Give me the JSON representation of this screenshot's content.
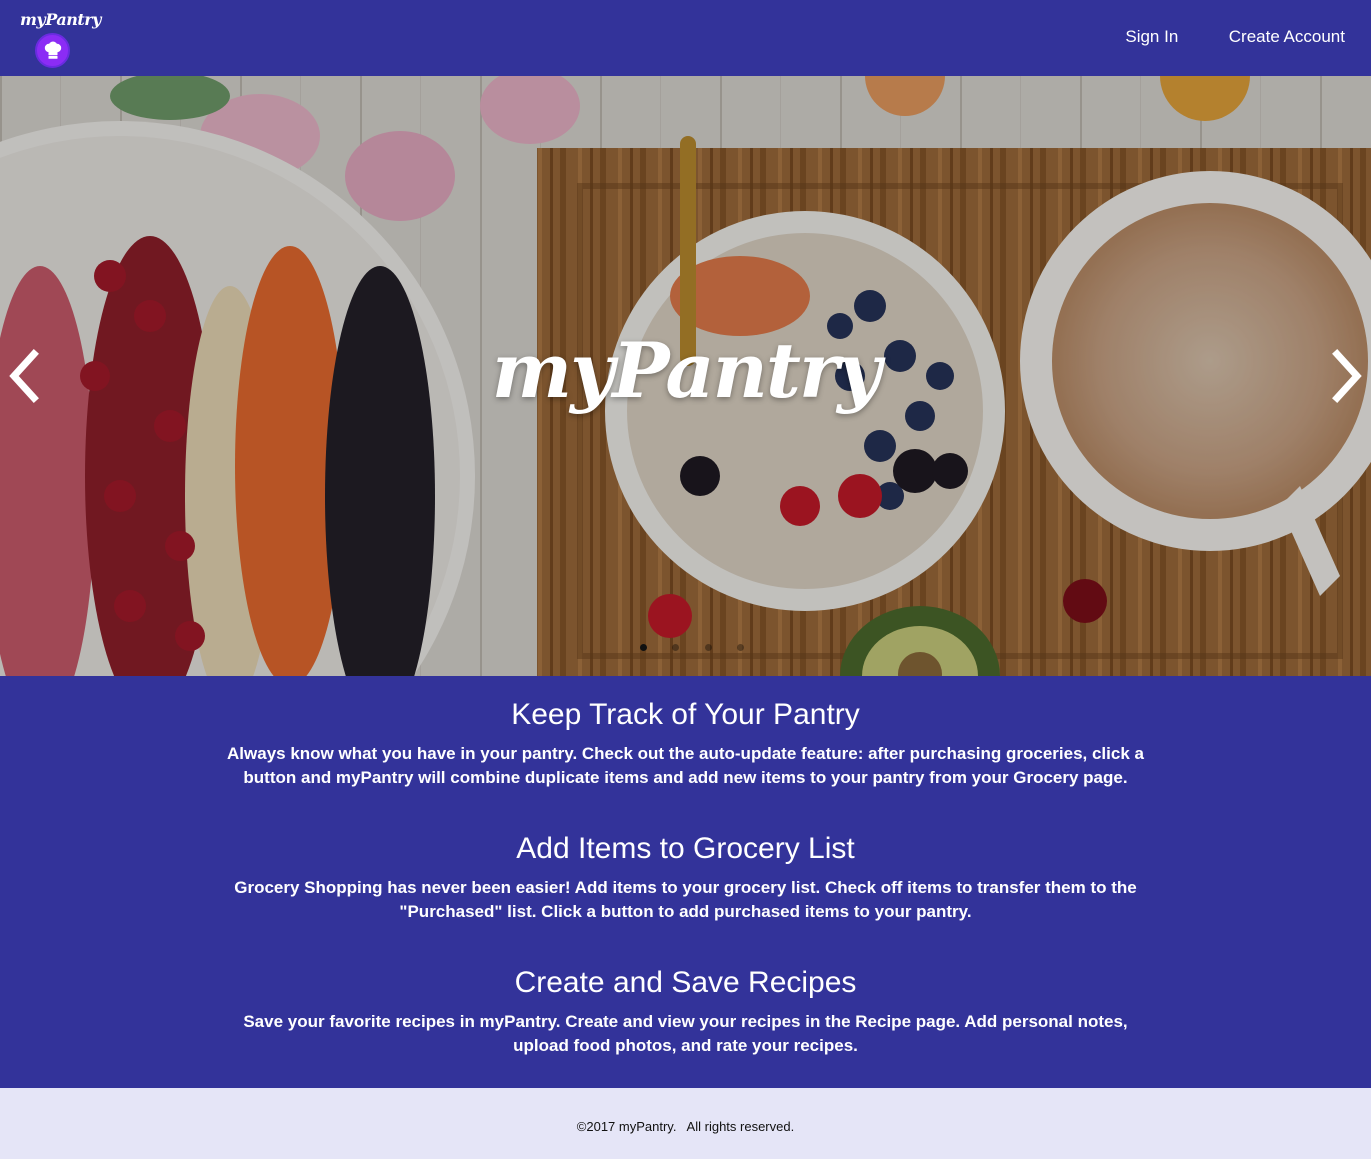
{
  "navbar": {
    "brand": "myPantry",
    "links": [
      "Sign In",
      "Create Account"
    ],
    "color": "#33339a"
  },
  "carousel": {
    "title": "myPantry",
    "slide_count": 4,
    "active_slide": 0,
    "icons": {
      "prev": "chevron-left-icon",
      "next": "chevron-right-icon"
    }
  },
  "features": [
    {
      "title": "Keep Track of Your Pantry",
      "text": "Always know what you have in your pantry. Check out the auto-update feature: after purchasing groceries, click a button and myPantry will combine duplicate items and add new items to your pantry from your Grocery page."
    },
    {
      "title": "Add Items to Grocery List",
      "text": "Grocery Shopping has never been easier! Add items to your grocery list. Check off items to transfer them to the \"Purchased\" list. Click a button to add purchased items to your pantry."
    },
    {
      "title": "Create and Save Recipes",
      "text": "Save your favorite recipes in myPantry. Create and view your recipes in the Recipe page. Add personal notes, upload food photos, and rate your recipes."
    }
  ],
  "footer": {
    "text": "©2017 myPantry.   All rights reserved."
  },
  "colors": {
    "primary": "#33339a",
    "badge": "#8b2cf5",
    "footer_bg": "#e5e5f7"
  }
}
